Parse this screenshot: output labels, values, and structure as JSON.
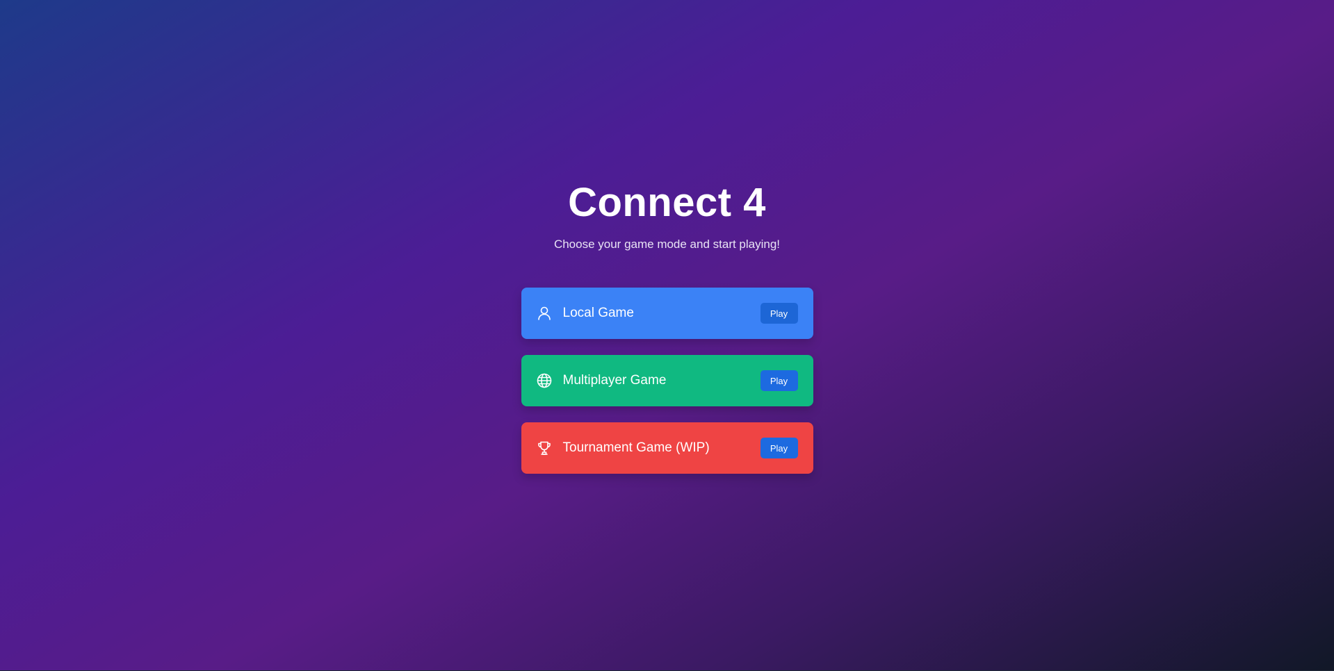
{
  "header": {
    "title": "Connect 4",
    "subtitle": "Choose your game mode and start playing!"
  },
  "modes": [
    {
      "label": "Local Game",
      "icon": "user-icon",
      "color": "#3b82f6",
      "button_label": "Play"
    },
    {
      "label": "Multiplayer Game",
      "icon": "globe-icon",
      "color": "#10b981",
      "button_label": "Play"
    },
    {
      "label": "Tournament Game (WIP)",
      "icon": "trophy-icon",
      "color": "#ef4444",
      "button_label": "Play"
    }
  ],
  "colors": {
    "background_start": "#1e3a8a",
    "background_mid": "#581c87",
    "background_end": "#111827",
    "button": "#1d6ae0"
  }
}
